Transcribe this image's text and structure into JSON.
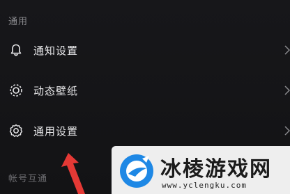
{
  "section_general": "通用",
  "section_account": "帐号互通",
  "rows": [
    {
      "label": "通知设置",
      "icon": "bell-icon"
    },
    {
      "label": "动态壁纸",
      "icon": "wallpaper-icon"
    },
    {
      "label": "通用设置",
      "icon": "gear-icon"
    }
  ],
  "watermark": {
    "title": "冰棱游戏网",
    "url": "www.yclengku.com"
  },
  "colors": {
    "background": "#141416",
    "text": "#e8e8ea",
    "header": "#8a8a8e",
    "arrow": "#e53935",
    "logo_blue": "#1e88e5"
  }
}
